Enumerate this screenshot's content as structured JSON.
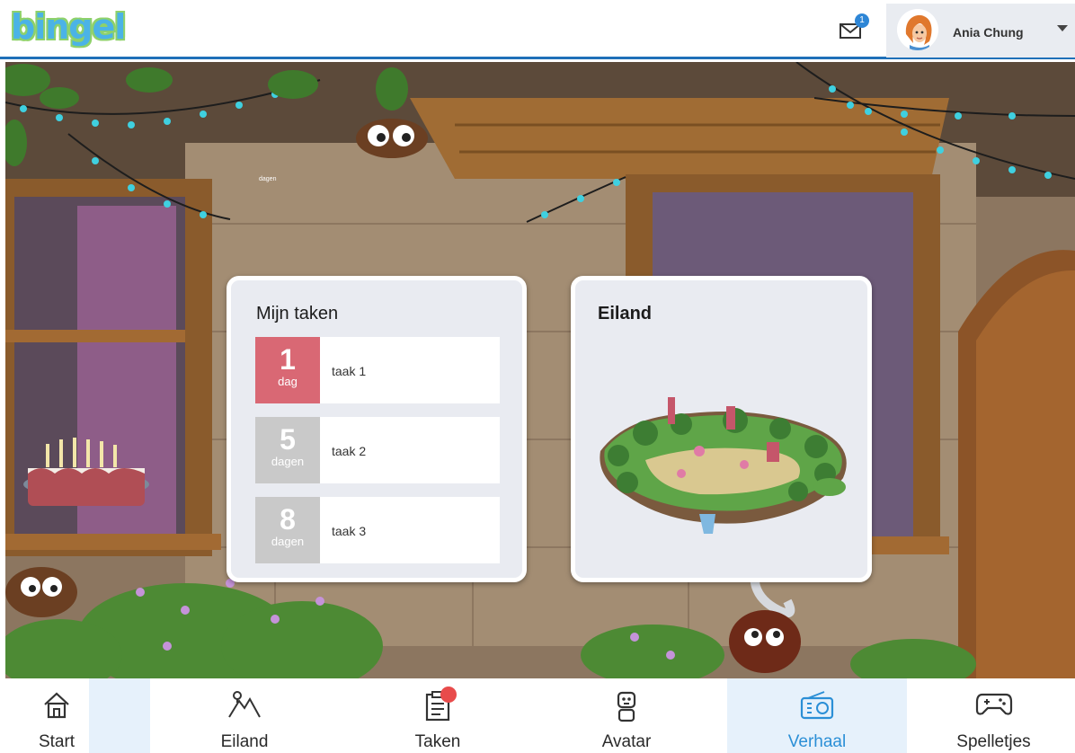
{
  "app": {
    "logo_text": "bingel"
  },
  "header": {
    "mail_count": "1",
    "user_name": "Ania Chung"
  },
  "scene": {
    "tiny_label": "dagen"
  },
  "tasks_card": {
    "title": "Mijn taken",
    "tasks": [
      {
        "days": "1",
        "unit": "dag",
        "label": "taak 1",
        "color": "#d96874"
      },
      {
        "days": "5",
        "unit": "dagen",
        "label": "taak 2",
        "color": "#c9c9c9"
      },
      {
        "days": "8",
        "unit": "dagen",
        "label": "taak 3",
        "color": "#c9c9c9"
      }
    ]
  },
  "island_card": {
    "title": "Eiland"
  },
  "nav": {
    "items": [
      {
        "label": "Start",
        "icon": "home-icon"
      },
      {
        "label": "Eiland",
        "icon": "mountain-icon"
      },
      {
        "label": "Taken",
        "icon": "clipboard-icon"
      },
      {
        "label": "Avatar",
        "icon": "robot-icon"
      },
      {
        "label": "Verhaal",
        "icon": "radio-icon",
        "active": true
      },
      {
        "label": "Spelletjes",
        "icon": "gamepad-icon"
      }
    ]
  },
  "colors": {
    "accent": "#2b8fd6",
    "header_line": "#1f70b8",
    "urgent": "#d96874",
    "notification": "#e84b4b"
  }
}
